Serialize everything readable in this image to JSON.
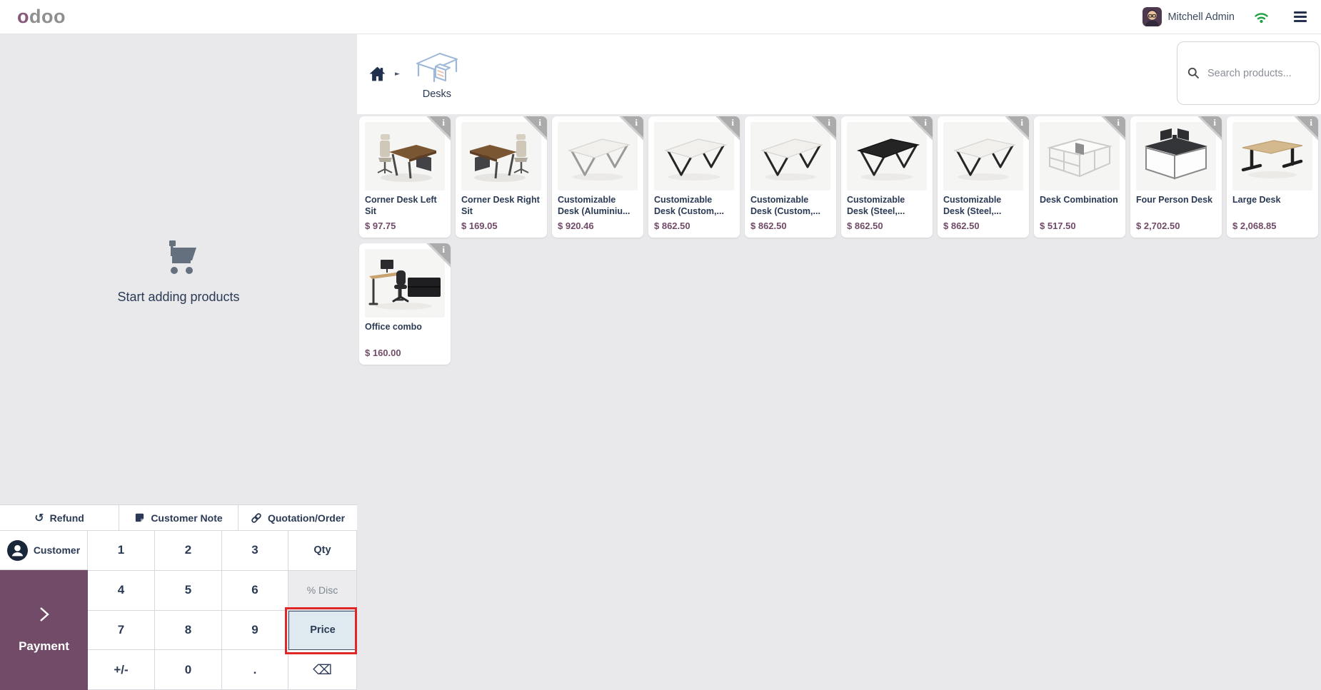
{
  "topbar": {
    "logo_o": "o",
    "logo_doo": "doo",
    "user_name": "Mitchell Admin"
  },
  "header": {
    "category_label": "Desks",
    "search_placeholder": "Search products..."
  },
  "cart_panel": {
    "empty_message": "Start adding products"
  },
  "order_actions": [
    {
      "label": "Refund",
      "icon": "refund-icon"
    },
    {
      "label": "Customer Note",
      "icon": "note-icon"
    },
    {
      "label": "Quotation/Order",
      "icon": "link-icon"
    }
  ],
  "customer_button": {
    "label": "Customer"
  },
  "payment_button": {
    "label": "Payment"
  },
  "numpad": {
    "keys": [
      {
        "label": "1"
      },
      {
        "label": "2"
      },
      {
        "label": "3"
      },
      {
        "label": "Qty",
        "mode": "active"
      },
      {
        "label": "4"
      },
      {
        "label": "5"
      },
      {
        "label": "6"
      },
      {
        "label": "% Disc",
        "mode": "muted"
      },
      {
        "label": "7"
      },
      {
        "label": "8"
      },
      {
        "label": "9"
      },
      {
        "label": "Price",
        "mode": "highlighted"
      },
      {
        "label": "+/-"
      },
      {
        "label": "0"
      },
      {
        "label": "."
      },
      {
        "label": "⌫"
      }
    ]
  },
  "products": [
    {
      "name": "Corner Desk Left Sit",
      "price": "$ 97.75",
      "image": "corner-desk-left"
    },
    {
      "name": "Corner Desk Right Sit",
      "price": "$ 169.05",
      "image": "corner-desk-right"
    },
    {
      "name": "Customizable Desk (Aluminiu...",
      "price": "$ 920.46",
      "image": "desk-white-gray"
    },
    {
      "name": "Customizable Desk (Custom,...",
      "price": "$ 862.50",
      "image": "desk-white-black"
    },
    {
      "name": "Customizable Desk (Custom,...",
      "price": "$ 862.50",
      "image": "desk-white-black"
    },
    {
      "name": "Customizable Desk (Steel,...",
      "price": "$ 862.50",
      "image": "desk-black"
    },
    {
      "name": "Customizable Desk (Steel,...",
      "price": "$ 862.50",
      "image": "desk-white-black"
    },
    {
      "name": "Desk Combination",
      "price": "$ 517.50",
      "image": "desk-combination"
    },
    {
      "name": "Four Person Desk",
      "price": "$ 2,702.50",
      "image": "four-person-desk"
    },
    {
      "name": "Large Desk",
      "price": "$ 2,068.85",
      "image": "large-desk"
    },
    {
      "name": "Office combo",
      "price": "$ 160.00",
      "image": "office-combo"
    }
  ],
  "icons": {
    "refund_glyph": "↺",
    "breadcrumb_arrow_glyph": "►",
    "info_glyph": "i"
  },
  "colors": {
    "accent_purple": "#714B67",
    "price_purple": "#714B67",
    "annotation_red": "#e02727",
    "wifi_green": "#1f9f3e",
    "text_navy": "#2b3a54",
    "background_gray": "#e9e9ec"
  }
}
